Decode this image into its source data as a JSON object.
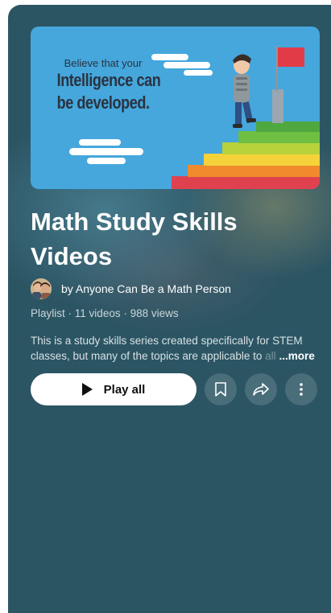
{
  "thumbnail": {
    "line1": "Believe that your",
    "line2": "Intelligence can",
    "line3": "be developed."
  },
  "playlist": {
    "title": "Math Study Skills Videos",
    "author": "by Anyone Can Be a Math Person",
    "type": "Playlist",
    "video_count": "11 videos",
    "views": "988 views",
    "separator": "·",
    "description_line1": "This is a study skills series created specifically for STEM",
    "description_line2": "classes, but many of the topics are applicable to",
    "description_fade": " all",
    "more_label": "...more"
  },
  "actions": {
    "play_all_label": "Play all",
    "save_icon": "bookmark-icon",
    "share_icon": "share-arrow-icon",
    "more_icon": "more-vertical-icon"
  },
  "colors": {
    "panel": "#2c5564",
    "thumbnail_sky": "#45a7dc",
    "play_button": "#ffffff"
  }
}
